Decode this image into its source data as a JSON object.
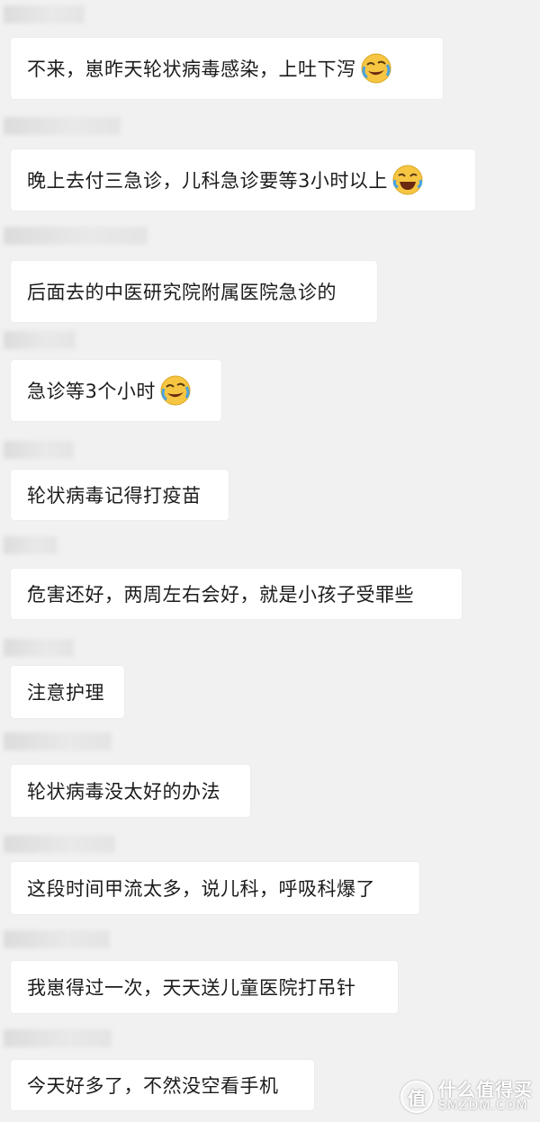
{
  "messages": [
    {
      "text": "不来，崽昨天轮状病毒感染，上吐下泻",
      "emoji": "crying-laughing-emoji"
    },
    {
      "text": "晚上去付三急诊，儿科急诊要等3小时以上",
      "emoji": "tears-of-joy-emoji"
    },
    {
      "text": "后面去的中医研究院附属医院急诊的",
      "emoji": ""
    },
    {
      "text": "急诊等3个小时",
      "emoji": "crying-laughing-emoji"
    },
    {
      "text": "轮状病毒记得打疫苗",
      "emoji": ""
    },
    {
      "text": "危害还好，两周左右会好，就是小孩子受罪些",
      "emoji": ""
    },
    {
      "text": "注意护理",
      "emoji": ""
    },
    {
      "text": "轮状病毒没太好的办法",
      "emoji": ""
    },
    {
      "text": "这段时间甲流太多，说儿科，呼吸科爆了",
      "emoji": ""
    },
    {
      "text": "我崽得过一次，天天送儿童医院打吊针",
      "emoji": ""
    },
    {
      "text": "今天好多了，不然没空看手机",
      "emoji": ""
    }
  ],
  "watermark": {
    "logo": "值",
    "name_cn": "什么值得买",
    "name_en": "SMZDM.COM"
  },
  "colors": {
    "background": "#f1f1f1",
    "bubble": "#ffffff",
    "text": "#1c1c1c",
    "emoji_face": "#f6c643"
  }
}
